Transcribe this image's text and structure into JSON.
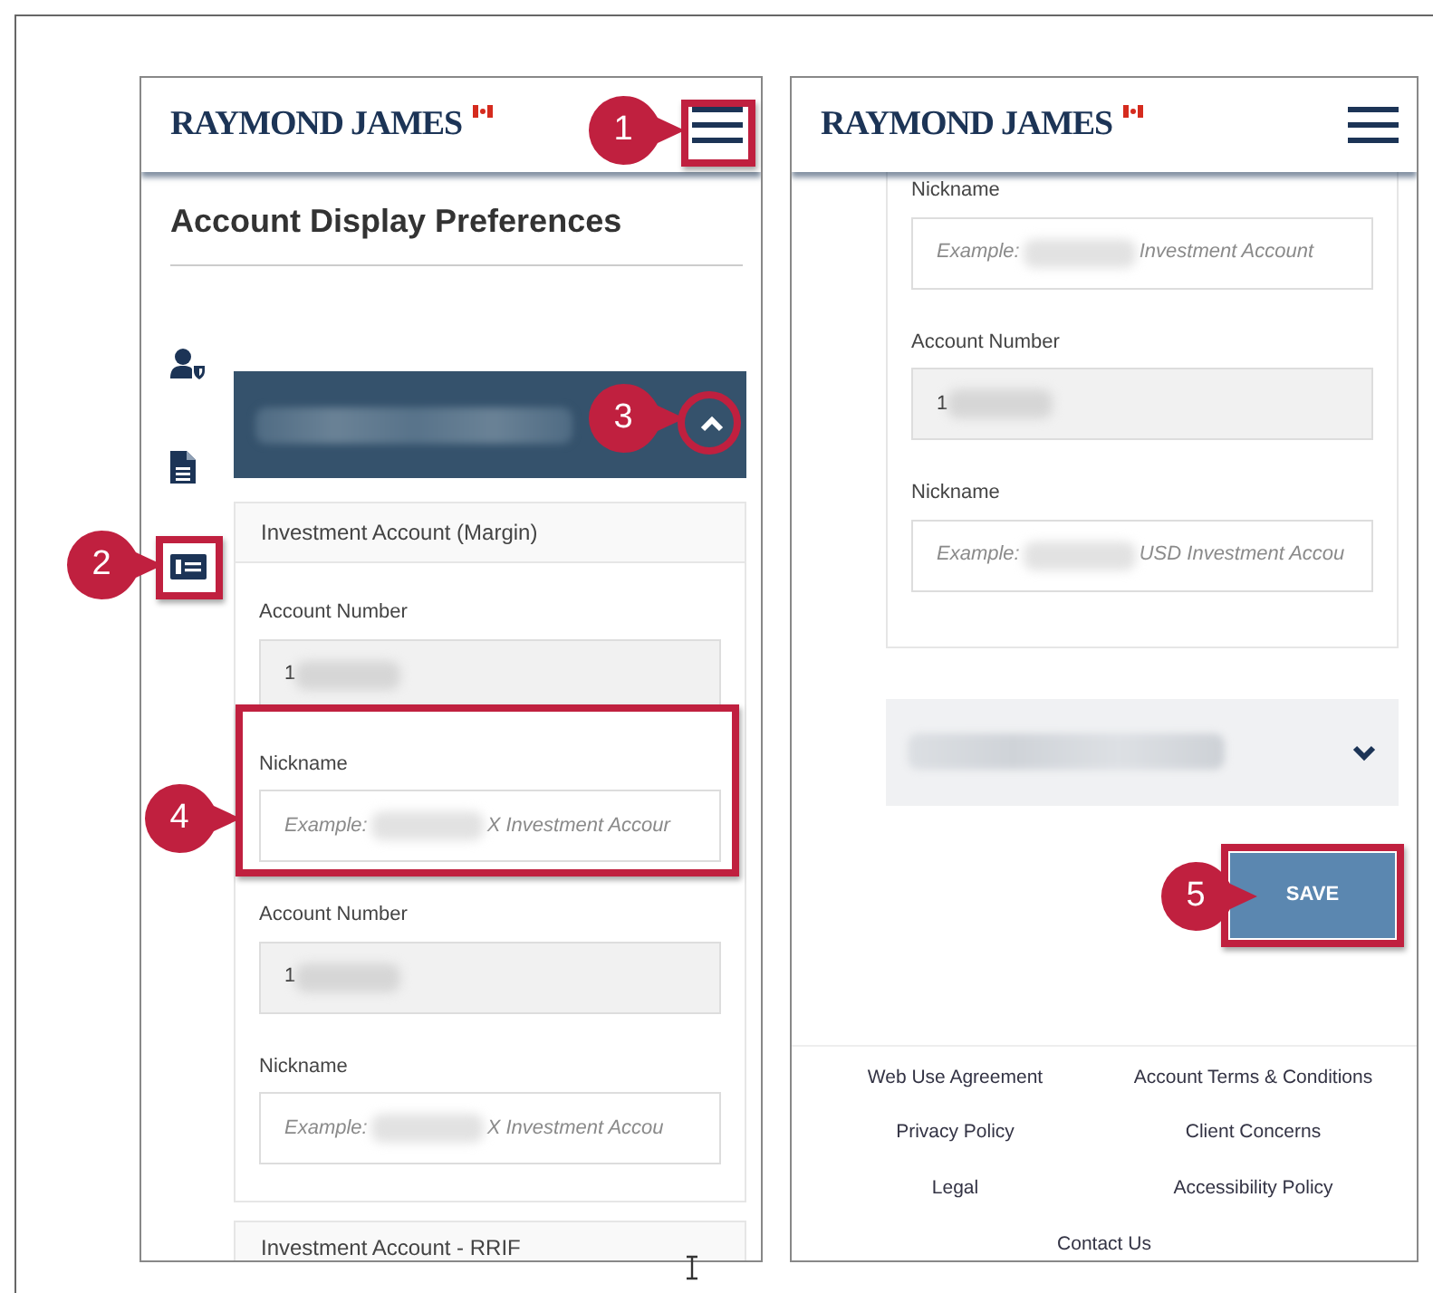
{
  "screens": [
    {
      "header": {
        "logo": "RAYMOND JAMES"
      },
      "title": "Account Display Preferences",
      "accordion": {
        "expanded": true
      },
      "card_title": "Investment Account (Margin)",
      "fields": [
        {
          "kind": "account",
          "label": "Account Number",
          "value": "1"
        },
        {
          "kind": "nickname",
          "label": "Nickname",
          "placeholder_start": "Example:",
          "placeholder_end": "X Investment Accour"
        },
        {
          "kind": "account",
          "label": "Account Number",
          "value": "1"
        },
        {
          "kind": "nickname",
          "label": "Nickname",
          "placeholder_start": "Example:",
          "placeholder_end": "X Investment Accou"
        }
      ],
      "next_card_title": "Investment Account - RRIF"
    },
    {
      "header": {
        "logo": "RAYMOND JAMES"
      },
      "fields": [
        {
          "kind": "nickname",
          "label": "Nickname",
          "placeholder_start": "Example:",
          "placeholder_end": "Investment Account"
        },
        {
          "kind": "account",
          "label": "Account Number",
          "value": "1"
        },
        {
          "kind": "nickname",
          "label": "Nickname",
          "placeholder_start": "Example:",
          "placeholder_end": "USD Investment Accou"
        }
      ],
      "accordion": {
        "expanded": false
      },
      "save_button": "SAVE",
      "footer_links": [
        "Web Use Agreement",
        "Account Terms & Conditions",
        "Privacy Policy",
        "Client Concerns",
        "Legal",
        "Accessibility Policy",
        "Contact Us"
      ]
    }
  ],
  "callouts": [
    {
      "number": "1"
    },
    {
      "number": "2"
    },
    {
      "number": "3"
    },
    {
      "number": "4"
    },
    {
      "number": "5"
    }
  ]
}
